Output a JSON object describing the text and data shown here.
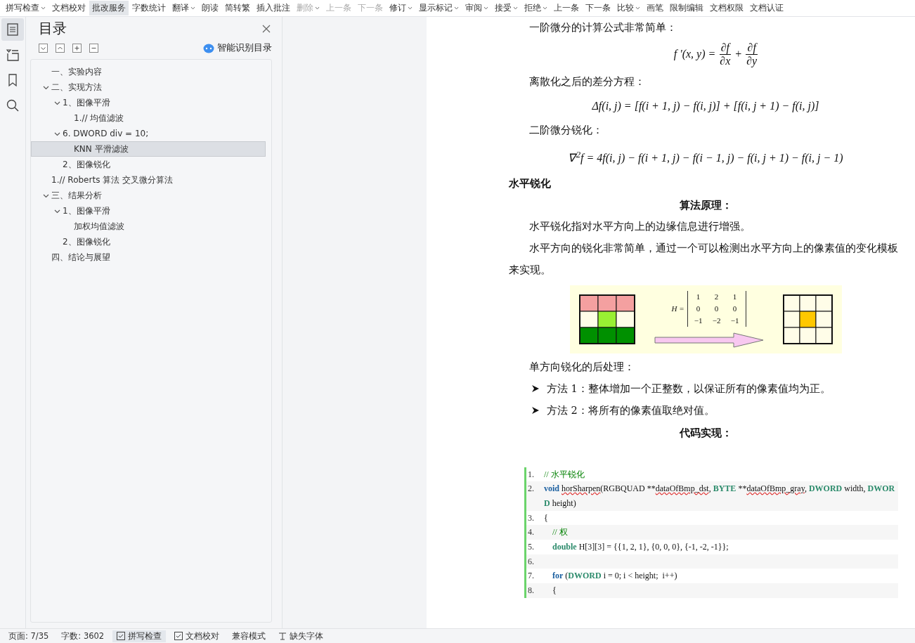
{
  "toolbar": [
    {
      "label": "拼写检查",
      "dropdown": true,
      "selected": false,
      "disabled": false
    },
    {
      "label": "文档校对",
      "dropdown": false,
      "selected": false,
      "disabled": false
    },
    {
      "label": "批改服务",
      "dropdown": false,
      "selected": true,
      "disabled": false
    },
    {
      "label": "字数统计",
      "dropdown": false,
      "selected": false,
      "disabled": false
    },
    {
      "label": "翻译",
      "dropdown": true,
      "selected": false,
      "disabled": false
    },
    {
      "label": "朗读",
      "dropdown": false,
      "selected": false,
      "disabled": false
    },
    {
      "label": "简转繁",
      "dropdown": false,
      "selected": false,
      "disabled": false
    },
    {
      "label": "插入批注",
      "dropdown": false,
      "selected": false,
      "disabled": false
    },
    {
      "label": "删除",
      "dropdown": true,
      "selected": false,
      "disabled": true
    },
    {
      "label": "上一条",
      "dropdown": false,
      "selected": false,
      "disabled": true
    },
    {
      "label": "下一条",
      "dropdown": false,
      "selected": false,
      "disabled": true
    },
    {
      "label": "修订",
      "dropdown": true,
      "selected": false,
      "disabled": false
    },
    {
      "label": "显示标记",
      "dropdown": true,
      "selected": false,
      "disabled": false
    },
    {
      "label": "审阅",
      "dropdown": true,
      "selected": false,
      "disabled": false
    },
    {
      "label": "接受",
      "dropdown": true,
      "selected": false,
      "disabled": false
    },
    {
      "label": "拒绝",
      "dropdown": true,
      "selected": false,
      "disabled": false
    },
    {
      "label": "上一条",
      "dropdown": false,
      "selected": false,
      "disabled": false
    },
    {
      "label": "下一条",
      "dropdown": false,
      "selected": false,
      "disabled": false
    },
    {
      "label": "比较",
      "dropdown": true,
      "selected": false,
      "disabled": false
    },
    {
      "label": "画笔",
      "dropdown": false,
      "selected": false,
      "disabled": false
    },
    {
      "label": "限制编辑",
      "dropdown": false,
      "selected": false,
      "disabled": false
    },
    {
      "label": "文档权限",
      "dropdown": false,
      "selected": false,
      "disabled": false
    },
    {
      "label": "文档认证",
      "dropdown": false,
      "selected": false,
      "disabled": false
    }
  ],
  "side_tabs": [
    {
      "kind": "toc",
      "selected": true
    },
    {
      "kind": "outline",
      "selected": false
    },
    {
      "kind": "bookmark",
      "selected": false
    },
    {
      "kind": "search",
      "selected": false
    }
  ],
  "toc_panel": {
    "title": "目录",
    "smart_button": "智能识别目录",
    "items": [
      {
        "label": "一、实验内容",
        "selected": false
      },
      {
        "label": "二、实现方法",
        "selected": false,
        "expanded": true,
        "children": [
          {
            "label": "1、图像平滑",
            "selected": false,
            "expanded": true,
            "children": [
              {
                "label": "1.// 均值滤波",
                "selected": false
              }
            ]
          },
          {
            "label": "6.   DWORD div = 10;",
            "selected": false,
            "expanded": true,
            "children": [
              {
                "label": "KNN 平滑滤波",
                "selected": true
              }
            ]
          },
          {
            "label": "2、图像锐化",
            "selected": false
          }
        ]
      },
      {
        "label": "1.// Roberts 算法 交叉微分算法",
        "selected": false
      },
      {
        "label": "三、结果分析",
        "selected": false,
        "expanded": true,
        "children": [
          {
            "label": "1、图像平滑",
            "selected": false,
            "expanded": true,
            "children": [
              {
                "label": "加权均值滤波",
                "selected": false
              }
            ]
          },
          {
            "label": "2、图像锐化",
            "selected": false
          }
        ]
      },
      {
        "label": "四、结论与展望",
        "selected": false
      }
    ]
  },
  "document": {
    "blocks": [
      {
        "kind": "para",
        "text": "一阶微分的计算公式非常简单："
      },
      {
        "kind": "fraction_formula",
        "lhs": "f '(x, y) =",
        "terms": [
          {
            "num": "∂f",
            "den": "∂x"
          },
          {
            "op": "+"
          },
          {
            "num": "∂f",
            "den": "∂y"
          }
        ]
      },
      {
        "kind": "para",
        "text": "离散化之后的差分方程："
      },
      {
        "kind": "formula",
        "text": "Δf(i, j) = [f(i + 1, j) − f(i, j)] + [f(i, j + 1) − f(i, j)]"
      },
      {
        "kind": "para",
        "text": "二阶微分锐化："
      },
      {
        "kind": "formula",
        "text": "∇$^{2}$f = 4f(i, j) − f(i + 1, j) − f(i − 1, j) − f(i, j + 1) − f(i, j − 1)"
      },
      {
        "kind": "heading",
        "text": "水平锐化"
      },
      {
        "kind": "center_heading",
        "text": "算法原理："
      },
      {
        "kind": "para",
        "text": "水平锐化指对水平方向上的边缘信息进行增强。"
      },
      {
        "kind": "para",
        "text": "水平方向的锐化非常简单，通过一个可以检测出水平方向上的像素值的变化模板来实现。"
      },
      {
        "kind": "figure",
        "matrix_label": "H =",
        "matrix": [
          [
            "1",
            "2",
            "1"
          ],
          [
            "0",
            "0",
            "0"
          ],
          [
            "−1",
            "−2",
            "−1"
          ]
        ]
      },
      {
        "kind": "para",
        "text": "单方向锐化的后处理："
      },
      {
        "kind": "bullet",
        "text": "方法 1：整体增加一个正整数，以保证所有的像素值均为正。"
      },
      {
        "kind": "bullet",
        "text": "方法 2：将所有的像素值取绝对值。"
      },
      {
        "kind": "center_heading",
        "text": "代码实现："
      },
      {
        "kind": "code",
        "lines": [
          {
            "number": "1.",
            "tokens": [
              {
                "kind": "comment",
                "text": "// 水平锐化"
              }
            ]
          },
          {
            "number": "2.",
            "tokens": [
              {
                "kind": "keyword",
                "text": "void "
              },
              {
                "kind": "misspelled",
                "text": "horSharpen"
              },
              {
                "kind": "plain",
                "text": "(RGBQUAD **"
              },
              {
                "kind": "misspelled",
                "text": "dataOfBmp_dst"
              },
              {
                "kind": "plain",
                "text": ", "
              },
              {
                "kind": "type",
                "text": "BYTE"
              },
              {
                "kind": "plain",
                "text": " **"
              },
              {
                "kind": "misspelled",
                "text": "dataOfBmp_gray"
              },
              {
                "kind": "plain",
                "text": ", "
              },
              {
                "kind": "type",
                "text": "DWORD"
              },
              {
                "kind": "plain",
                "text": " width, "
              },
              {
                "kind": "type",
                "text": "DWORD"
              },
              {
                "kind": "plain",
                "text": " height)"
              }
            ]
          },
          {
            "number": "3.",
            "tokens": [
              {
                "kind": "plain",
                "text": "{"
              }
            ]
          },
          {
            "number": "4.",
            "indent": true,
            "tokens": [
              {
                "kind": "comment",
                "text": "// 权"
              }
            ]
          },
          {
            "number": "5.",
            "indent": true,
            "tokens": [
              {
                "kind": "type",
                "text": "double"
              },
              {
                "kind": "plain",
                "text": " H[3][3] = {{1, 2, 1}, {0, 0, 0}, {-1, -2, -1}};"
              }
            ]
          },
          {
            "number": "6."
          },
          {
            "number": "7.",
            "indent": true,
            "tokens": [
              {
                "kind": "keyword",
                "text": "for"
              },
              {
                "kind": "plain",
                "text": " ("
              },
              {
                "kind": "type",
                "text": "DWORD"
              },
              {
                "kind": "plain",
                "text": " i = 0; i < height;  i++)"
              }
            ]
          },
          {
            "number": "8.",
            "indent": true,
            "tokens": [
              {
                "kind": "plain",
                "text": "{"
              }
            ]
          }
        ]
      }
    ]
  },
  "status_bar": [
    {
      "kind": "text",
      "label": "页面: 7/35",
      "selected": false
    },
    {
      "kind": "text",
      "label": "字数: 3602",
      "selected": false
    },
    {
      "kind": "check",
      "label": "拼写检查",
      "selected": true
    },
    {
      "kind": "check",
      "label": "文档校对",
      "selected": false
    },
    {
      "kind": "text",
      "label": "兼容模式",
      "selected": false
    },
    {
      "kind": "font",
      "label": "缺失字体",
      "selected": false
    }
  ]
}
